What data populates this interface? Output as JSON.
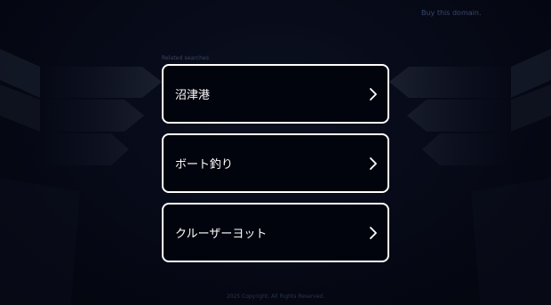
{
  "header": {
    "buy_label": "Buy this domain."
  },
  "related": {
    "label": "Related searches",
    "items": [
      {
        "label": "沼津港"
      },
      {
        "label": "ボート釣り"
      },
      {
        "label": "クルーザーヨット"
      }
    ]
  },
  "footer": {
    "text": "2025 Copyright. All Rights Reserved."
  },
  "colors": {
    "background": "#050814",
    "card_border": "#ffffff",
    "card_text": "#ffffff"
  }
}
